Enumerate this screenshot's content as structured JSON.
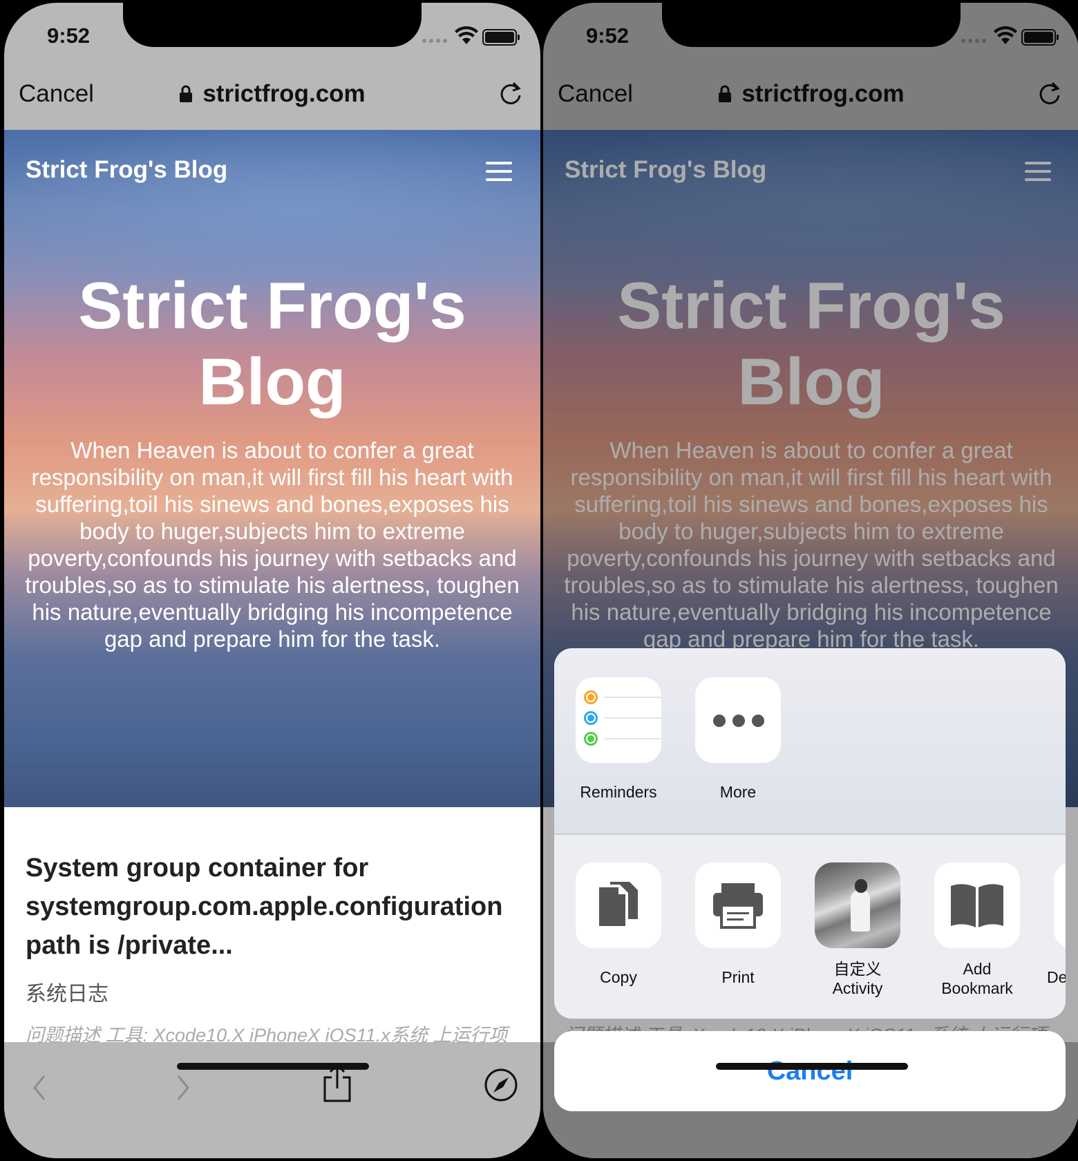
{
  "status": {
    "time": "9:52"
  },
  "browser": {
    "cancel": "Cancel",
    "url": "strictfrog.com"
  },
  "blog": {
    "brand": "Strict Frog's Blog",
    "hero_title_line1": "Strict Frog's",
    "hero_title_line2": "Blog",
    "subtitle": "When Heaven is about to confer a great responsibility on man,it will first fill his heart with suffering,toil his sinews and bones,exposes his body to huger,subjects him to extreme poverty,confounds his journey with setbacks and troubles,so as to stimulate his alertness, toughen his nature,eventually bridging his incompetence gap and prepare him for the task."
  },
  "post": {
    "title": "System group container for\nsystemgroup.com.apple.configuration\npath is /private...",
    "category": "系统日志",
    "description": "问题描述 工具: Xcode10.X iPhoneX iOS11.x系统 上运行项"
  },
  "share_sheet": {
    "row1": [
      {
        "label": "Reminders",
        "icon": "reminders-icon"
      },
      {
        "label": "More",
        "icon": "more-icon"
      }
    ],
    "row2": [
      {
        "label": "Copy",
        "icon": "copy-icon"
      },
      {
        "label": "Print",
        "icon": "print-icon"
      },
      {
        "label_line1": "自定义",
        "label_line2": "Activity",
        "icon": "custom-activity-photo"
      },
      {
        "label_line1": "Add",
        "label_line2": "Bookmark",
        "icon": "bookmark-icon"
      },
      {
        "label": "De",
        "icon": "partial-icon"
      }
    ],
    "cancel": "Cancel"
  },
  "colors": {
    "accent": "#1a7ef0",
    "reminder_orange": "#f7a42a",
    "reminder_blue": "#2ea8ec",
    "reminder_green": "#4fce48"
  }
}
